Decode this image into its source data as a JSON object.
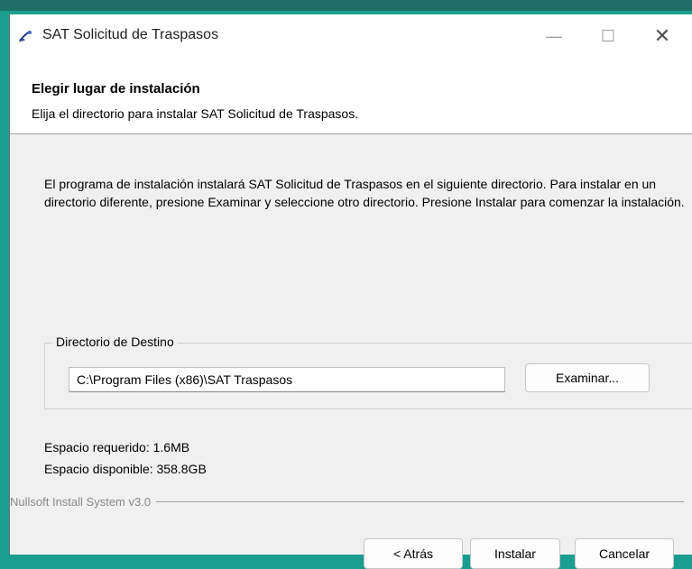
{
  "window": {
    "title": "SAT Solicitud de Traspasos",
    "minimize": "—",
    "maximize": "☐",
    "close": "✕"
  },
  "header": {
    "title": "Elegir lugar de instalación",
    "subtitle": "Elija el directorio para instalar SAT Solicitud de Traspasos."
  },
  "body": {
    "description": "El programa de instalación instalará SAT Solicitud de Traspasos en el siguiente directorio. Para instalar en un directorio diferente, presione Examinar y seleccione otro directorio. Presione Instalar para comenzar la instalación."
  },
  "destination": {
    "legend": "Directorio de Destino",
    "path": "C:\\Program Files (x86)\\SAT Traspasos",
    "browse_label": "Examinar..."
  },
  "space": {
    "required": "Espacio requerido: 1.6MB",
    "available": "Espacio disponible: 358.8GB"
  },
  "footer": {
    "brand": "Nullsoft Install System v3.0",
    "back_label": "< Atrás",
    "install_label": "Instalar",
    "cancel_label": "Cancelar"
  },
  "colors": {
    "desktop": "#1a9e8f",
    "dialog_bg": "#f0f0f0",
    "header_bg": "#ffffff"
  }
}
